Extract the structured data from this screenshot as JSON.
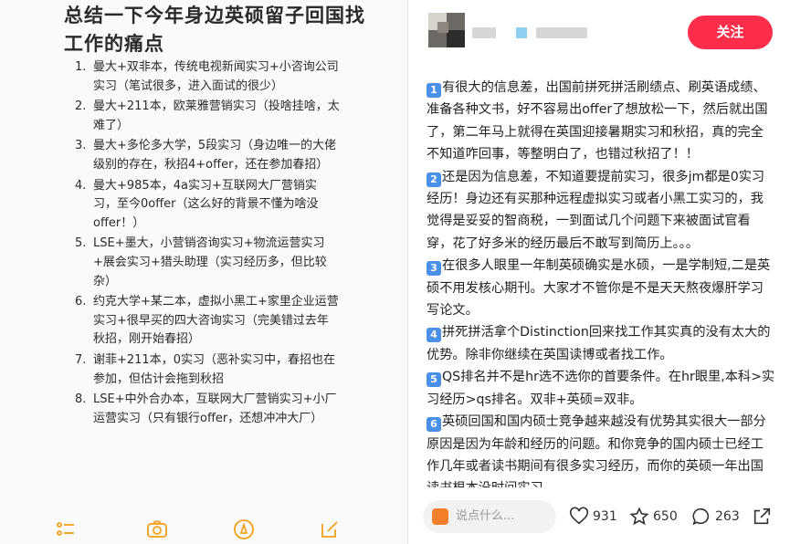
{
  "notes": {
    "title": "总结一下今年身边英硕留子回国找工作的痛点",
    "items": [
      {
        "num": "1.",
        "text": "曼大+双非本，传统电视新闻实习+小咨询公司实习（笔试很多，进入面试的很少）"
      },
      {
        "num": "2.",
        "text": "曼大+211本，欧莱雅营销实习（投啥挂啥，太难了）"
      },
      {
        "num": "3.",
        "text": "曼大+多伦多大学，5段实习（身边唯一的大佬级别的存在，秋招4+offer，还在参加春招）"
      },
      {
        "num": "4.",
        "text": "曼大+985本，4a实习+互联网大厂营销实习，至今0offer（这么好的背景不懂为啥没offer！）"
      },
      {
        "num": "5.",
        "text": "LSE+墨大，小营销咨询实习+物流运营实习+展会实习+猎头助理（实习经历多，但比较杂）"
      },
      {
        "num": "6.",
        "text": "约克大学+某二本，虚拟小黑工+家里企业运营实习+很早买的四大咨询实习（完美错过去年秋招，刚开始春招）"
      },
      {
        "num": "7.",
        "text": "谢菲+211本，0实习（恶补实习中，春招也在参加，但估计会拖到秋招"
      },
      {
        "num": "8.",
        "text": "LSE+中外合办本，互联网大厂营销实习+小厂运营实习（只有银行offer，还想冲冲大厂）"
      }
    ]
  },
  "post": {
    "follow_label": "关注",
    "paragraphs": [
      {
        "badge": "1",
        "text": "有很大的信息差，出国前拼死拼活刷绩点、刷英语成绩、准备各种文书，好不容易出offer了想放松一下，然后就出国了，第二年马上就得在英国迎接暑期实习和秋招，真的完全不知道咋回事，等整明白了，也错过秋招了！！"
      },
      {
        "badge": "2",
        "text": "还是因为信息差，不知道要提前实习，很多jm都是0实习经历！身边还有买那种远程虚拟实习或者小黑工实习的，我觉得是妥妥的智商税，一到面试几个问题下来被面试官看穿，花了好多米的经历最后不敢写到简历上。。。"
      },
      {
        "badge": "3",
        "text": "在很多人眼里一年制英硕确实是水硕，一是学制短,二是英硕不用发核心期刊。大家才不管你是不是天天熬夜爆肝学习写论文。"
      },
      {
        "badge": "4",
        "text": "拼死拼活拿个Distinction回来找工作其实真的没有太大的优势。除非你继续在英国读博或者找工作。"
      },
      {
        "badge": "5",
        "text": "QS排名并不是hr选不选你的首要条件。在hr眼里,本科>实习经历>qs排名。双非+英硕=双非。"
      },
      {
        "badge": "6",
        "text": "英硕回国和国内硕士竞争越来越没有优势其实很大一部分原因是因为年龄和经历的问题。和你竞争的国内硕士已经工作几年或者读书期间有很多实习经历，而你的英硕一年出国读书根本没时间实习。"
      }
    ],
    "comment_placeholder": "说点什么...",
    "likes": "931",
    "favorites": "650",
    "comments": "263"
  },
  "colors": {
    "follow": "#ff2d4a",
    "badge": "#4a8fe8",
    "toolbar_icons": "#f2a01b"
  }
}
